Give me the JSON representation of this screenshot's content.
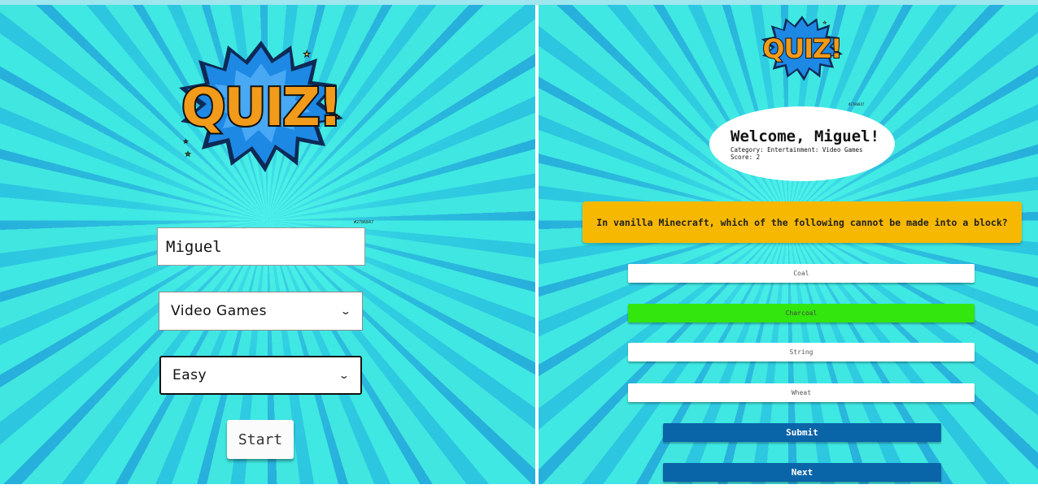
{
  "left_panel": {
    "logo_text": "QUIZ!",
    "code_tag": "#2786847",
    "name_input": {
      "value": "Miguel",
      "placeholder": ""
    },
    "category_select": {
      "selected": "Video Games"
    },
    "difficulty_select": {
      "selected": "Easy"
    },
    "start_label": "Start"
  },
  "right_panel": {
    "logo_text": "QUIZ!",
    "code_tag": "#2786847",
    "welcome": {
      "title": "Welcome, Miguel!",
      "category": "Category: Entertainment: Video Games",
      "score": "Score: 2"
    },
    "question": "In vanilla Minecraft, which of the following cannot be made into a block?",
    "answers": [
      {
        "label": "Coal",
        "selected": false
      },
      {
        "label": "Charcoal",
        "selected": true
      },
      {
        "label": "String",
        "selected": false
      },
      {
        "label": "Wheat",
        "selected": false
      }
    ],
    "submit_label": "Submit",
    "next_label": "Next"
  },
  "colors": {
    "background_cyan": "#3fe8e2",
    "question_yellow": "#f7b801",
    "selected_green": "#33e60d",
    "button_blue": "#0a64a8",
    "logo_orange": "#f29a1a",
    "logo_blue": "#1e88e5"
  }
}
